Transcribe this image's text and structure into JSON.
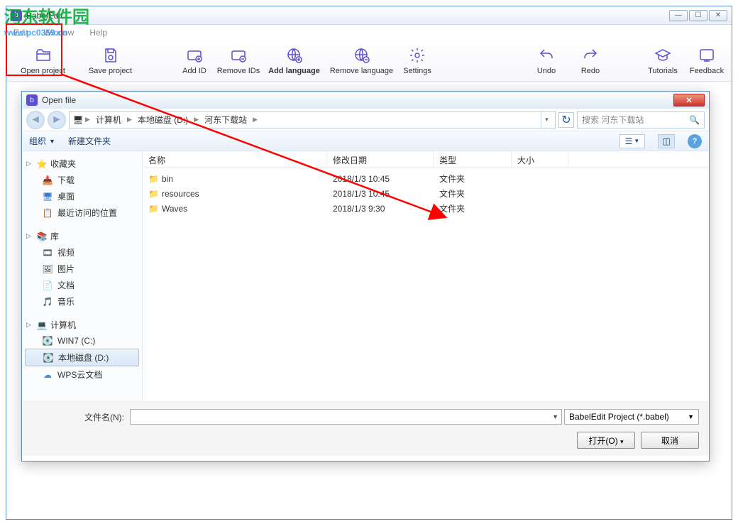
{
  "app": {
    "title": "BabelEdit",
    "menu": {
      "edit": "Edit",
      "window": "Window",
      "help": "Help"
    },
    "win_controls": {
      "min": "—",
      "max": "☐",
      "close": "✕"
    }
  },
  "toolbar": {
    "open_project": "Open project",
    "save_project": "Save project",
    "add_id": "Add ID",
    "remove_ids": "Remove IDs",
    "add_language": "Add language",
    "remove_language": "Remove language",
    "settings": "Settings",
    "undo": "Undo",
    "redo": "Redo",
    "tutorials": "Tutorials",
    "feedback": "Feedback"
  },
  "dialog": {
    "title": "Open file",
    "breadcrumb": [
      "计算机",
      "本地磁盘 (D:)",
      "河东下载站"
    ],
    "search_placeholder": "搜索 河东下载站",
    "toolbar2": {
      "organize": "组织",
      "newfolder": "新建文件夹"
    },
    "columns": {
      "name": "名称",
      "modified": "修改日期",
      "type": "类型",
      "size": "大小"
    },
    "col_widths": {
      "name": 260,
      "modified": 150,
      "type": 110,
      "size": 80
    },
    "files": [
      {
        "name": "bin",
        "modified": "2018/1/3 10:45",
        "type": "文件夹"
      },
      {
        "name": "resources",
        "modified": "2018/1/3 10:45",
        "type": "文件夹"
      },
      {
        "name": "Waves",
        "modified": "2018/1/3 9:30",
        "type": "文件夹"
      }
    ],
    "tree": {
      "favorites": {
        "label": "收藏夹",
        "items": [
          "下载",
          "桌面",
          "最近访问的位置"
        ]
      },
      "libraries": {
        "label": "库",
        "items": [
          "视频",
          "图片",
          "文档",
          "音乐"
        ]
      },
      "computer": {
        "label": "计算机",
        "items": [
          "WIN7 (C:)",
          "本地磁盘 (D:)",
          "WPS云文档"
        ],
        "selected": 1
      }
    },
    "footer": {
      "filename_label": "文件名(N):",
      "filename_value": "",
      "filter": "BabelEdit Project (*.babel)",
      "open": "打开(O)",
      "cancel": "取消"
    }
  },
  "watermark": {
    "line1": "河东软件园",
    "line2": "www.pc0359.cn"
  }
}
